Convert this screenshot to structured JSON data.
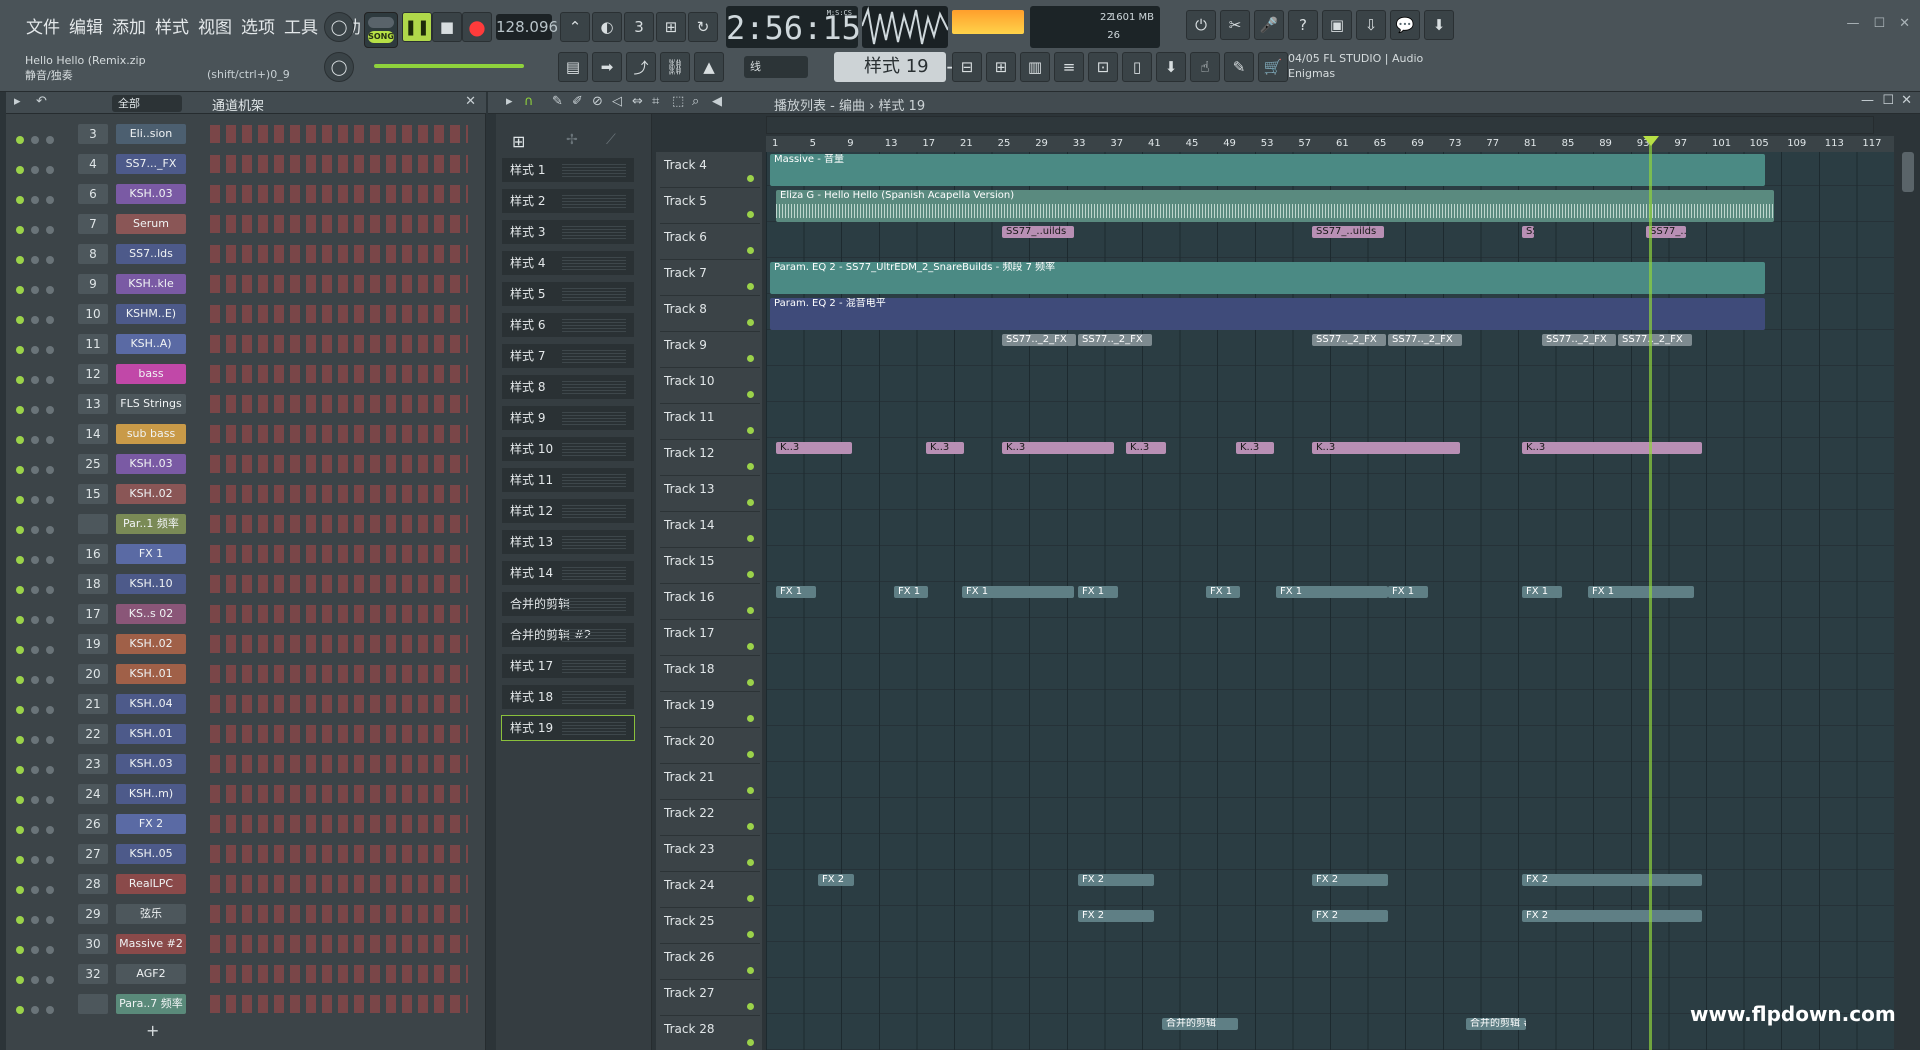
{
  "menu": [
    "文件",
    "编辑",
    "添加",
    "样式",
    "视图",
    "选项",
    "工具",
    "帮助"
  ],
  "song": {
    "title": "Hello Hello  (Remix.zip",
    "mode": "静音/独奏",
    "hint": "(shift/ctrl+)0_9"
  },
  "transport": {
    "song_label": "SONG",
    "tempo": "128.096",
    "time": "2:56:15",
    "time_unit": "M:S:CS"
  },
  "cpu": {
    "mem": "1601 MB",
    "cpu": "22",
    "poly": "26"
  },
  "pattern": {
    "selected": "样式 19",
    "snap": "线"
  },
  "news": {
    "line1": "04/05  FL STUDIO | Audio",
    "line2": "Enigmas"
  },
  "rack": {
    "filter": "全部",
    "title": "通道机架"
  },
  "playlist": {
    "breadcrumb": "播放列表 - 编曲 › 样式 19"
  },
  "channels": [
    {
      "num": "3",
      "name": "Eli..sion",
      "color": "#4c5f70"
    },
    {
      "num": "4",
      "name": "SS7..._FX",
      "color": "#4d5a8a"
    },
    {
      "num": "6",
      "name": "KSH..03",
      "color": "#7a5aa4"
    },
    {
      "num": "7",
      "name": "Serum",
      "color": "#8a5656"
    },
    {
      "num": "8",
      "name": "SS7..lds",
      "color": "#4d5a8a"
    },
    {
      "num": "9",
      "name": "KSH..kle",
      "color": "#7a5aa4"
    },
    {
      "num": "10",
      "name": "KSHM..E)",
      "color": "#4d5a8a"
    },
    {
      "num": "11",
      "name": "KSH..A)",
      "color": "#5a6aa4"
    },
    {
      "num": "12",
      "name": "bass",
      "color": "#c148a8"
    },
    {
      "num": "13",
      "name": "FLS Strings",
      "color": "#4d575c"
    },
    {
      "num": "14",
      "name": "sub  bass",
      "color": "#c99a48"
    },
    {
      "num": "25",
      "name": "KSH..03",
      "color": "#7a5aa4"
    },
    {
      "num": "15",
      "name": "KSH..02",
      "color": "#8a5656"
    },
    {
      "num": "",
      "name": "Par..1 频率",
      "color": "#7a8a56"
    },
    {
      "num": "16",
      "name": "FX 1",
      "color": "#5a6aa4"
    },
    {
      "num": "18",
      "name": "KSH..10",
      "color": "#4d5a8a"
    },
    {
      "num": "17",
      "name": "KS..s 02",
      "color": "#8a5678"
    },
    {
      "num": "19",
      "name": "KSH..02",
      "color": "#a06048"
    },
    {
      "num": "20",
      "name": "KSH..01",
      "color": "#a06048"
    },
    {
      "num": "21",
      "name": "KSH..04",
      "color": "#4d5a8a"
    },
    {
      "num": "22",
      "name": "KSH..01",
      "color": "#4d5a8a"
    },
    {
      "num": "23",
      "name": "KSH..03",
      "color": "#4d5a8a"
    },
    {
      "num": "24",
      "name": "KSH..m)",
      "color": "#4d5a8a"
    },
    {
      "num": "26",
      "name": "FX 2",
      "color": "#5a6aa4"
    },
    {
      "num": "27",
      "name": "KSH..05",
      "color": "#4d5a8a"
    },
    {
      "num": "28",
      "name": "RealLPC",
      "color": "#8a4a4a"
    },
    {
      "num": "29",
      "name": "弦乐",
      "color": "#4d575c"
    },
    {
      "num": "30",
      "name": "Massive #2",
      "color": "#8a4a4a"
    },
    {
      "num": "32",
      "name": "AGF2",
      "color": "#4d575c"
    },
    {
      "num": "",
      "name": "Para..7 频率",
      "color": "#5a8a7a"
    }
  ],
  "picker": [
    "样式 1",
    "样式 2",
    "样式 3",
    "样式 4",
    "样式 5",
    "样式 6",
    "样式 7",
    "样式 8",
    "样式 9",
    "样式 10",
    "样式 11",
    "样式 12",
    "样式 13",
    "样式 14",
    "合并的剪辑",
    "合并的剪辑 #2",
    "样式 17",
    "样式 18",
    "样式 19"
  ],
  "tracks": [
    "Track 4",
    "Track 5",
    "Track 6",
    "Track 7",
    "Track 8",
    "Track 9",
    "Track 10",
    "Track 11",
    "Track 12",
    "Track 13",
    "Track 14",
    "Track 15",
    "Track 16",
    "Track 17",
    "Track 18",
    "Track 19",
    "Track 20",
    "Track 21",
    "Track 22",
    "Track 23",
    "Track 24",
    "Track 25",
    "Track 26",
    "Track 27",
    "Track 28"
  ],
  "ruler": [
    "1",
    "5",
    "9",
    "13",
    "17",
    "21",
    "25",
    "29",
    "33",
    "37",
    "41",
    "45",
    "49",
    "53",
    "57",
    "61",
    "65",
    "69",
    "73",
    "77",
    "81",
    "85",
    "89",
    "93",
    "97",
    "101",
    "105",
    "109",
    "113",
    "117"
  ],
  "clips": {
    "massive": "Massive - 音量",
    "eliza": "Eliza G - Hello Hello (Spanish Acapella Version)",
    "eq7": "Param. EQ 2 - SS77_UltrEDM_2_SnareBuilds - 频段 7 频率",
    "eq2": "Param. EQ 2 - 混音电平",
    "uilds": "SS77_..uilds",
    "fx": "SS77.._2_FX",
    "k3": "K..3",
    "fx1": "FX 1",
    "fx2": "FX 2",
    "merged": "合并的剪辑",
    "merged2": "合并的剪辑 #2"
  },
  "watermark": "www.flpdown.com",
  "colors": {
    "accent": "#9bd24a",
    "playhead": "#8fd23c",
    "record": "#ff3b3b"
  }
}
